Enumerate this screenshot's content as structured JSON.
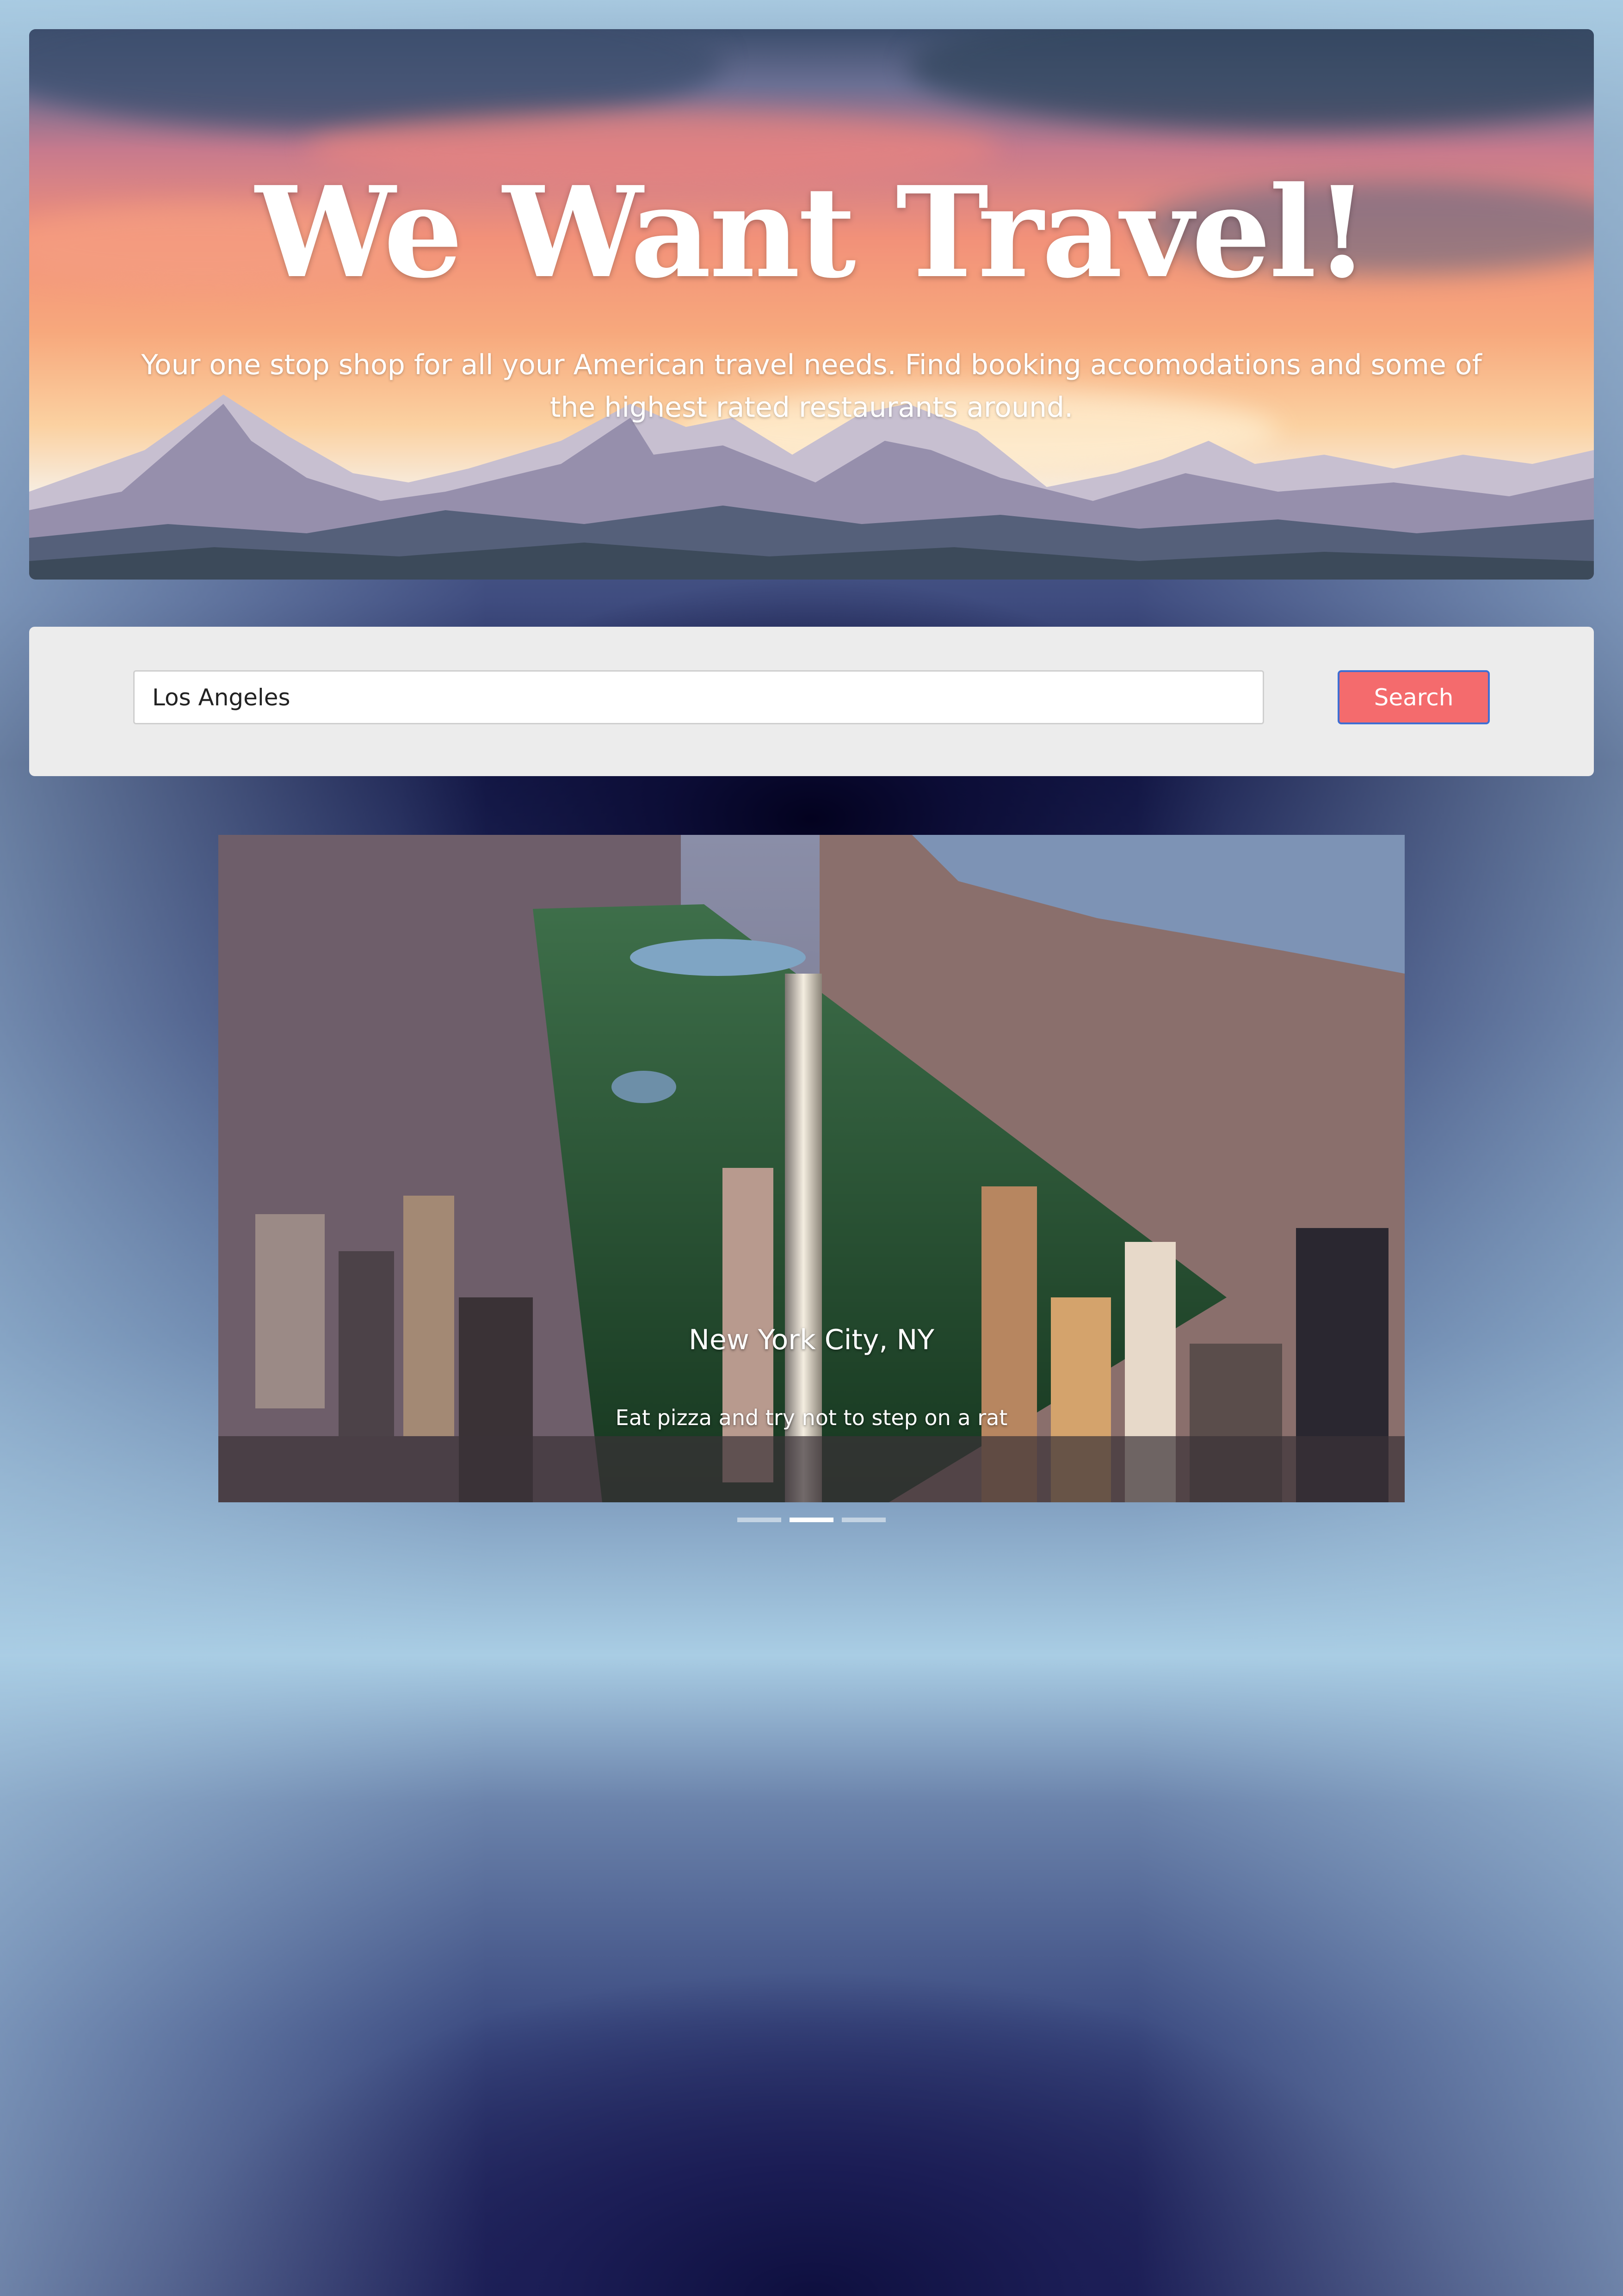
{
  "hero": {
    "title": "We Want Travel!",
    "subtitle": "Your one stop shop for all your American travel needs. Find booking accomodations and some of the highest rated restaurants around."
  },
  "search": {
    "value": "Los Angeles",
    "button_label": "Search"
  },
  "carousel": {
    "active_index": 1,
    "slide_count": 3,
    "caption_title": "New York City, NY",
    "caption_text": "Eat pizza and try not to step on a rat"
  },
  "colors": {
    "search_button": "#f46b6d",
    "search_button_border": "#3f6fd3",
    "panel_background": "#ececec"
  }
}
